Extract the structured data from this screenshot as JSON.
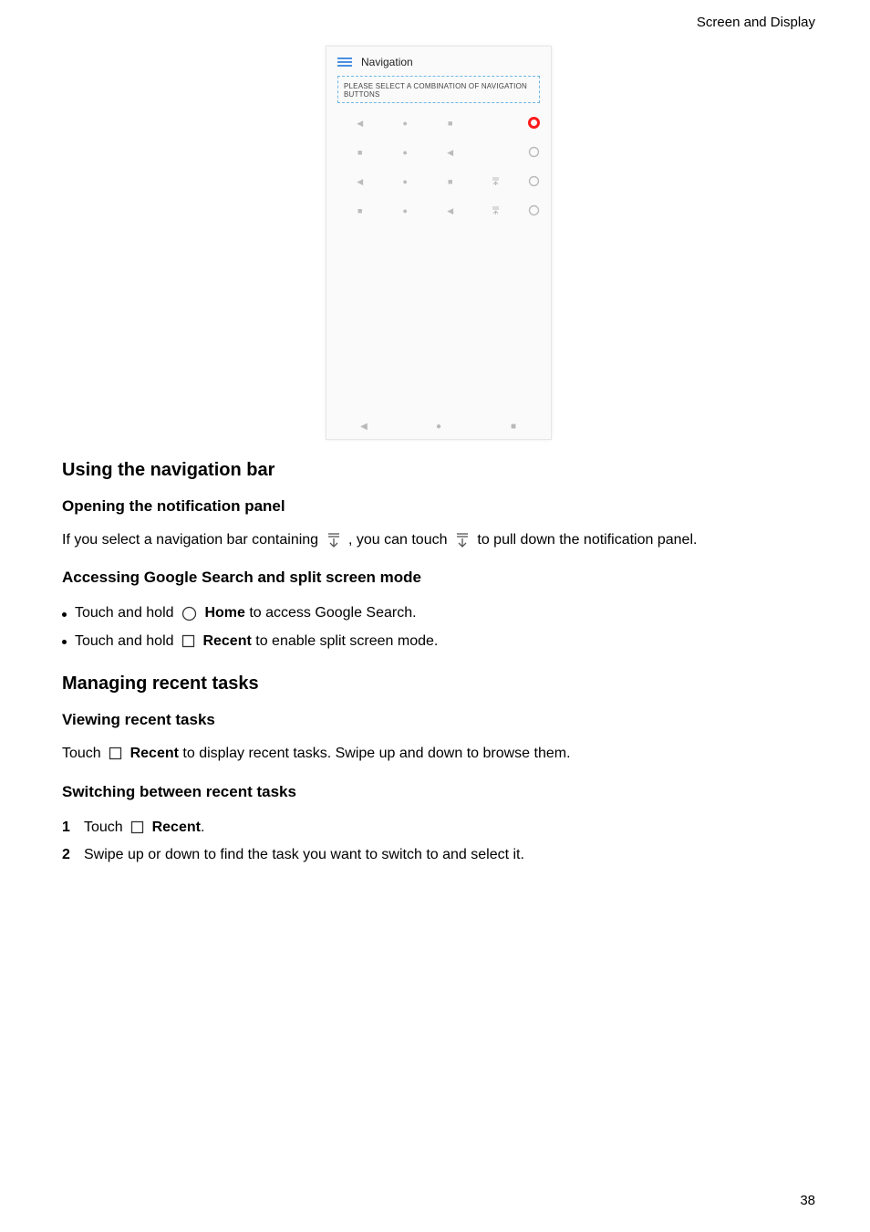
{
  "header": {
    "section": "Screen and Display"
  },
  "screenshot": {
    "title": "Navigation",
    "banner": "PLEASE SELECT A COMBINATION OF NAVIGATION BUTTONS"
  },
  "h_using": "Using the navigation bar",
  "h_open_panel": "Opening the notification panel",
  "p_open_1": "If you select a navigation bar containing ",
  "p_open_2": " , you can touch ",
  "p_open_3": "  to pull down the notification panel.",
  "h_google": "Accessing Google Search and split screen mode",
  "b_google_1a": "Touch and hold ",
  "b_google_1b": " Home",
  "b_google_1c": " to access Google Search.",
  "b_google_2a": "Touch and hold ",
  "b_google_2b": " Recent",
  "b_google_2c": " to enable split screen mode.",
  "h_manage": "Managing recent tasks",
  "h_view": "Viewing recent tasks",
  "p_view_a": "Touch ",
  "p_view_b": " Recent",
  "p_view_c": " to display recent tasks. Swipe up and down to browse them.",
  "h_switch": "Switching between recent tasks",
  "n1_a": "Touch ",
  "n1_b": " Recent",
  "n1_c": ".",
  "n2": "Swipe up or down to find the task you want to switch to and select it.",
  "num1": "1",
  "num2": "2",
  "page": "38"
}
